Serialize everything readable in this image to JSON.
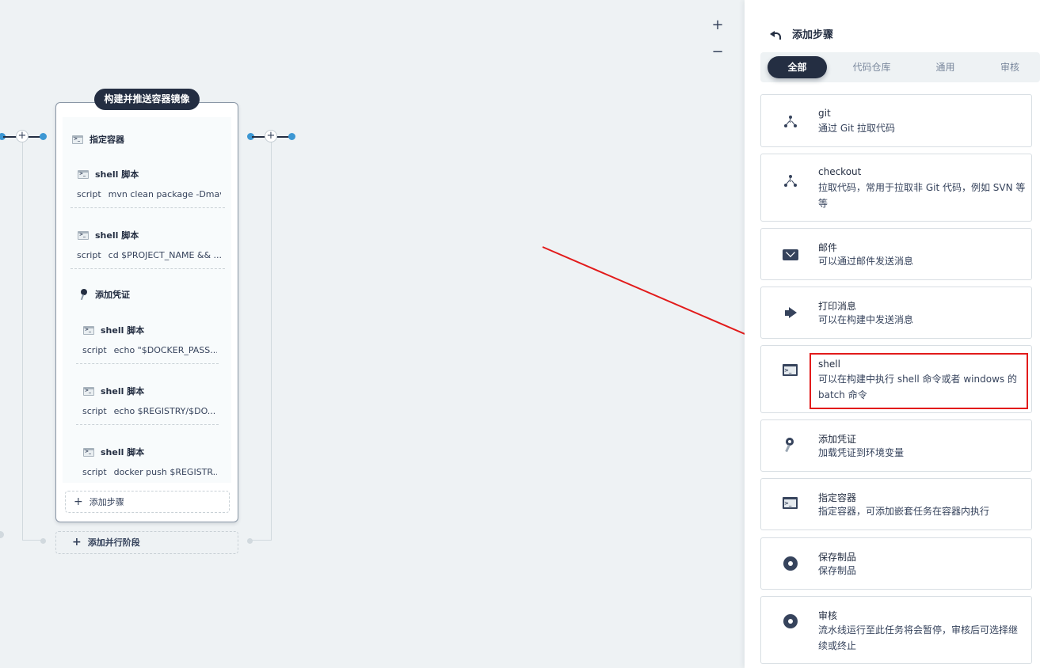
{
  "canvas": {
    "zoom_in": "+",
    "zoom_out": "−",
    "stage": {
      "title": "构建并推送容器镜像",
      "container_label": "指定容器",
      "credential_label": "添加凭证",
      "steps": [
        {
          "label": "shell 脚本",
          "key": "script",
          "value": "mvn clean package -Dmav..."
        },
        {
          "label": "shell 脚本",
          "key": "script",
          "value": "cd $PROJECT_NAME && ..."
        },
        {
          "label": "shell 脚本",
          "key": "script",
          "value": "echo \"$DOCKER_PASS..."
        },
        {
          "label": "shell 脚本",
          "key": "script",
          "value": "echo $REGISTRY/$DO..."
        },
        {
          "label": "shell 脚本",
          "key": "script",
          "value": "docker push $REGISTR..."
        }
      ],
      "add_step": "添加步骤",
      "add_parallel": "添加并行阶段"
    }
  },
  "panel": {
    "title": "添加步骤",
    "tabs": [
      "全部",
      "代码仓库",
      "通用",
      "审核"
    ],
    "active_tab": "全部",
    "items": [
      {
        "name": "git",
        "desc": "通过 Git 拉取代码",
        "icon": "branch-icon"
      },
      {
        "name": "checkout",
        "desc": "拉取代码，常用于拉取非 Git 代码，例如 SVN 等等",
        "icon": "branch-icon"
      },
      {
        "name": "邮件",
        "desc": "可以通过邮件发送消息",
        "icon": "mail-icon"
      },
      {
        "name": "打印消息",
        "desc": "可以在构建中发送消息",
        "icon": "megaphone-icon"
      },
      {
        "name": "shell",
        "desc": "可以在构建中执行 shell 命令或者 windows 的 batch 命令",
        "icon": "terminal-icon"
      },
      {
        "name": "添加凭证",
        "desc": "加载凭证到环境变量",
        "icon": "key-icon"
      },
      {
        "name": "指定容器",
        "desc": "指定容器，可添加嵌套任务在容器内执行",
        "icon": "terminal-icon"
      },
      {
        "name": "保存制品",
        "desc": "保存制品",
        "icon": "disc-icon"
      },
      {
        "name": "审核",
        "desc": "流水线运行至此任务将会暂停，审核后可选择继续或终止",
        "icon": "disc-icon"
      }
    ]
  },
  "colors": {
    "accent_dark": "#242e42",
    "connector_dot": "#3c97d3",
    "annotation_red": "#e21b1b"
  }
}
